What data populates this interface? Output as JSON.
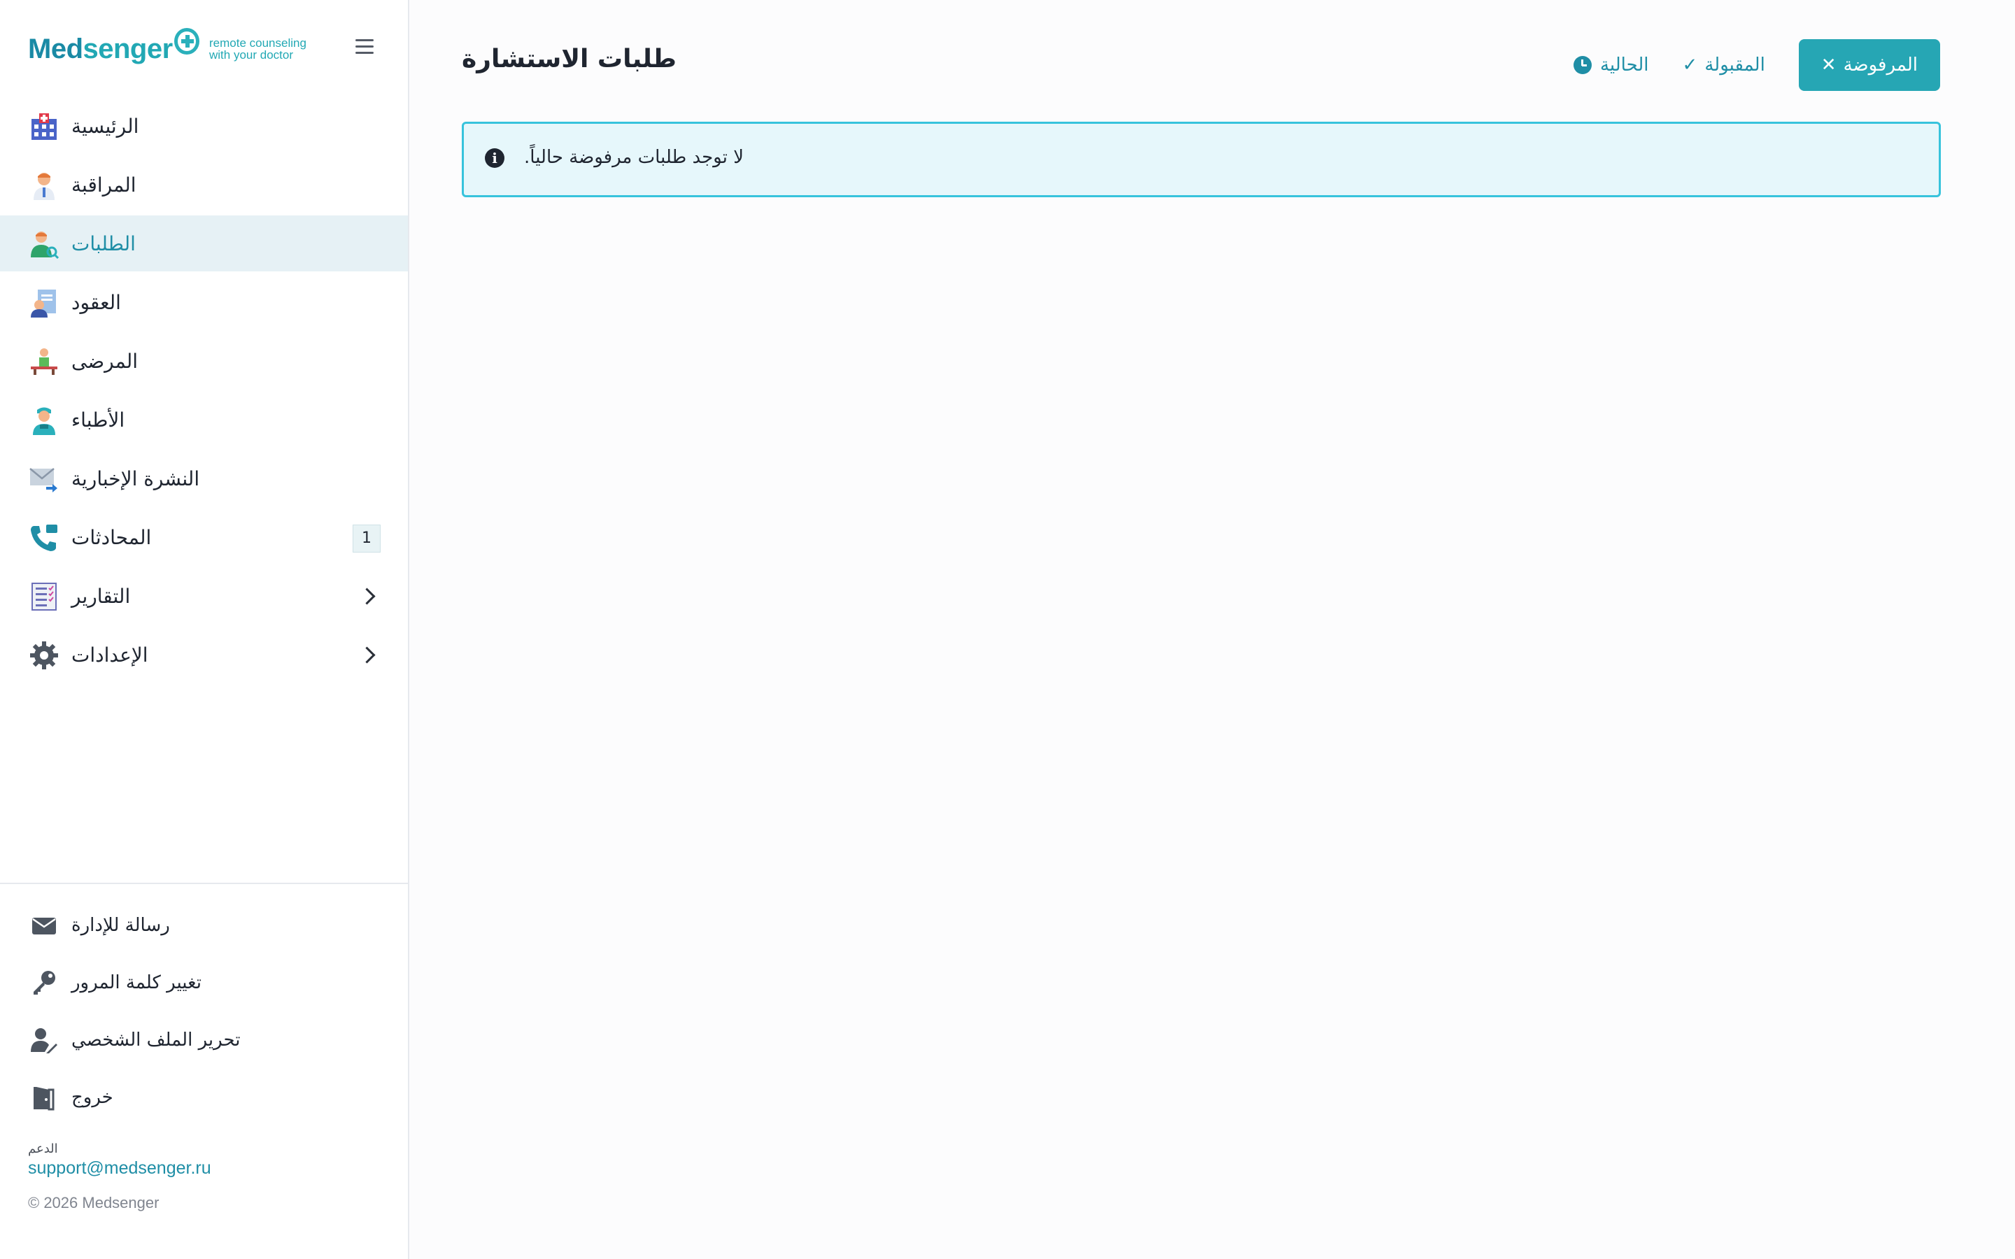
{
  "logo": {
    "name_part1": "Med",
    "name_part2": "senger",
    "tagline_line1": "remote counseling",
    "tagline_line2": "with your doctor"
  },
  "sidebar": {
    "items": [
      {
        "label": "الرئيسية",
        "icon": "hospital-icon"
      },
      {
        "label": "المراقبة",
        "icon": "doctor-icon"
      },
      {
        "label": "الطلبات",
        "icon": "user-search-icon",
        "active": true
      },
      {
        "label": "العقود",
        "icon": "contract-icon"
      },
      {
        "label": "المرضى",
        "icon": "patient-icon"
      },
      {
        "label": "الأطباء",
        "icon": "nurse-icon"
      },
      {
        "label": "النشرة الإخبارية",
        "icon": "mail-send-icon"
      },
      {
        "label": "المحادثات",
        "icon": "phone-icon",
        "badge": "1"
      },
      {
        "label": "التقارير",
        "icon": "report-icon"
      },
      {
        "label": "الإعدادات",
        "icon": "gear-icon"
      }
    ],
    "bottom_items": [
      {
        "label": "رسالة للإدارة",
        "icon": "envelope-icon"
      },
      {
        "label": "تغيير كلمة المرور",
        "icon": "key-icon"
      },
      {
        "label": "تحرير الملف الشخصي",
        "icon": "user-edit-icon"
      },
      {
        "label": "خروج",
        "icon": "door-exit-icon"
      }
    ],
    "support_title": "الدعم",
    "support_email": "support@medsenger.ru",
    "copyright": "© 2026 Medsenger"
  },
  "main": {
    "title": "طلبات الاستشارة",
    "tabs": {
      "rejected": "المرفوضة",
      "accepted": "المقبولة",
      "current": "الحالية"
    },
    "alert_text": ".لا توجد طلبات مرفوضة حالياً"
  },
  "colors": {
    "accent": "#26a6b4",
    "link": "#1f8ea6",
    "active_bg": "#e6f1f5",
    "alert_bg": "#e6f7fb",
    "alert_border": "#37c3dc"
  }
}
